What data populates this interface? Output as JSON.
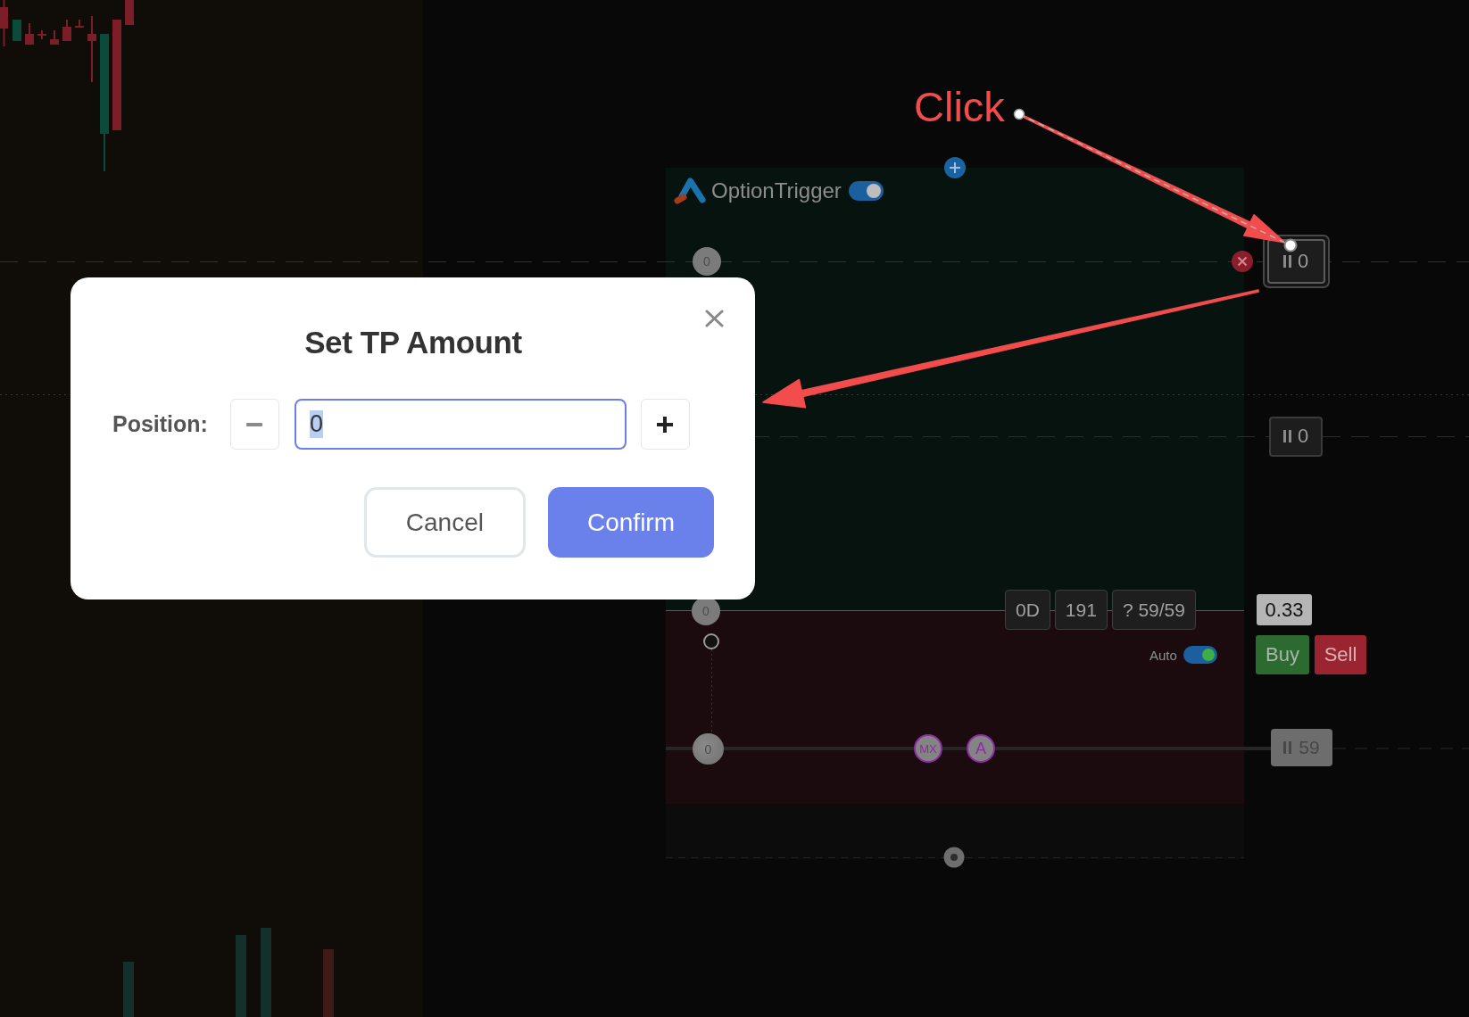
{
  "annotation": {
    "label": "Click"
  },
  "option_trigger": {
    "title": "OptionTrigger",
    "enabled": true,
    "take_profit_lines": [
      {
        "handle": "0",
        "quantity": "0",
        "selected": true
      },
      {
        "quantity": "0",
        "selected": false
      }
    ],
    "entry_line": {
      "handle": "0",
      "tags": [
        "0D",
        "191",
        "? 59/59"
      ],
      "price": "0.33",
      "auto": {
        "label": "Auto",
        "on": true
      },
      "buy": "Buy",
      "sell": "Sell"
    },
    "stop_line": {
      "handle": "0",
      "markers": [
        "MX",
        "A"
      ],
      "quantity": "59"
    }
  },
  "dialog": {
    "title": "Set TP Amount",
    "position_field": {
      "label": "Position:",
      "value": "0",
      "focused": true,
      "text_selected": true
    },
    "buttons": [
      {
        "label": "Cancel",
        "kind": "secondary"
      },
      {
        "label": "Confirm",
        "kind": "primary"
      }
    ]
  }
}
